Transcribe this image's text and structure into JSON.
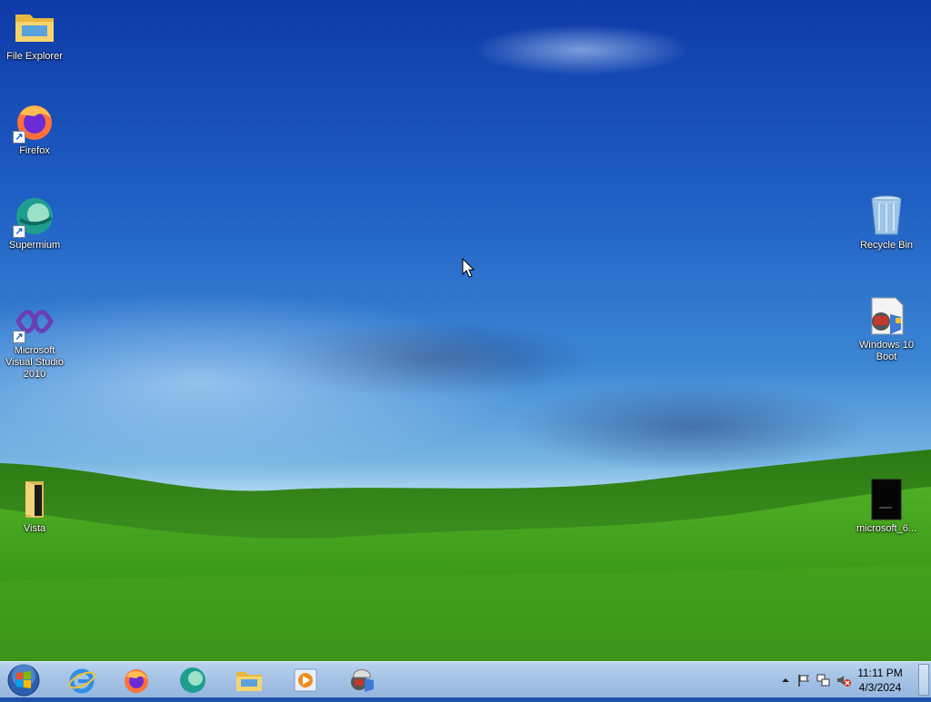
{
  "desktop": {
    "icons_left": [
      {
        "label": "File Explorer",
        "icon": "folder-explorer-icon",
        "shortcut": false
      },
      {
        "label": "Firefox",
        "icon": "firefox-icon",
        "shortcut": true
      },
      {
        "label": "Supermium",
        "icon": "supermium-icon",
        "shortcut": true
      },
      {
        "label": "Microsoft Visual Studio 2010",
        "icon": "visual-studio-icon",
        "shortcut": true
      },
      {
        "label": "Vista",
        "icon": "folder-vista-icon",
        "shortcut": false
      }
    ],
    "icons_right": [
      {
        "label": "Recycle Bin",
        "icon": "recycle-bin-icon",
        "shortcut": false
      },
      {
        "label": "Windows 10 Boot",
        "icon": "windows-boot-icon",
        "shortcut": false
      },
      {
        "label": "microsoft_6...",
        "icon": "black-file-icon",
        "shortcut": false
      }
    ],
    "shortcut_arrow": "↗"
  },
  "taskbar": {
    "start": "windows-start-orb-icon",
    "pinned": [
      "internet-explorer-icon",
      "firefox-icon",
      "supermium-icon",
      "file-explorer-icon",
      "media-player-icon",
      "windows-boot-icon"
    ],
    "tray": [
      "show-hidden-icons",
      "action-center-flag-icon",
      "network-icon",
      "volume-muted-icon"
    ],
    "clock": {
      "time": "11:11 PM",
      "date": "4/3/2024"
    }
  },
  "colors": {
    "taskbar": "#a6c3e6",
    "sky": "#1f5fc4",
    "grass": "#3f9a1e"
  }
}
